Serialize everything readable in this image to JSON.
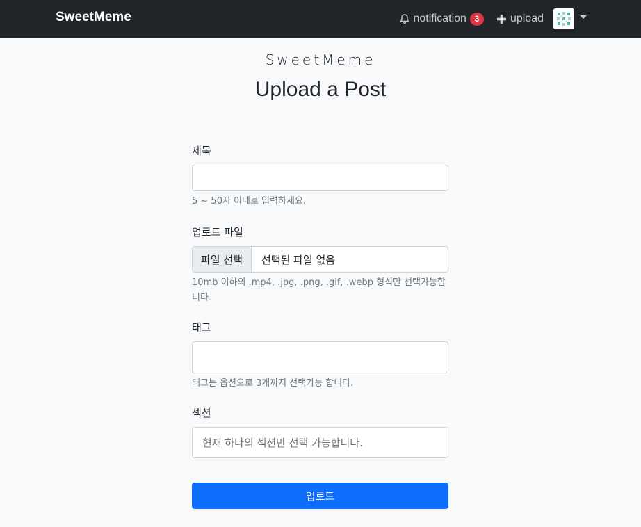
{
  "navbar": {
    "brand": "SweetMeme",
    "notification_label": "notification",
    "notification_count": "3",
    "upload_label": "upload"
  },
  "header": {
    "subtitle": "SweetMeme",
    "title": "Upload a Post"
  },
  "form": {
    "title_label": "제목",
    "title_help": "5 ~ 50자 이내로 입력하세요.",
    "file_label": "업로드 파일",
    "file_button": "파일 선택",
    "file_status": "선택된 파일 없음",
    "file_help": "10mb 이하의 .mp4, .jpg, .png, .gif, .webp 형식만 선택가능합니다.",
    "tag_label": "태그",
    "tag_help": "태그는 옵션으로 3개까지 선택가능 합니다.",
    "section_label": "섹션",
    "section_placeholder": "현재 하나의 섹션만 선택 가능합니다.",
    "submit_label": "업로드"
  },
  "colors": {
    "navbar_bg": "#212529",
    "primary": "#0d6efd",
    "badge": "#dc3545"
  }
}
